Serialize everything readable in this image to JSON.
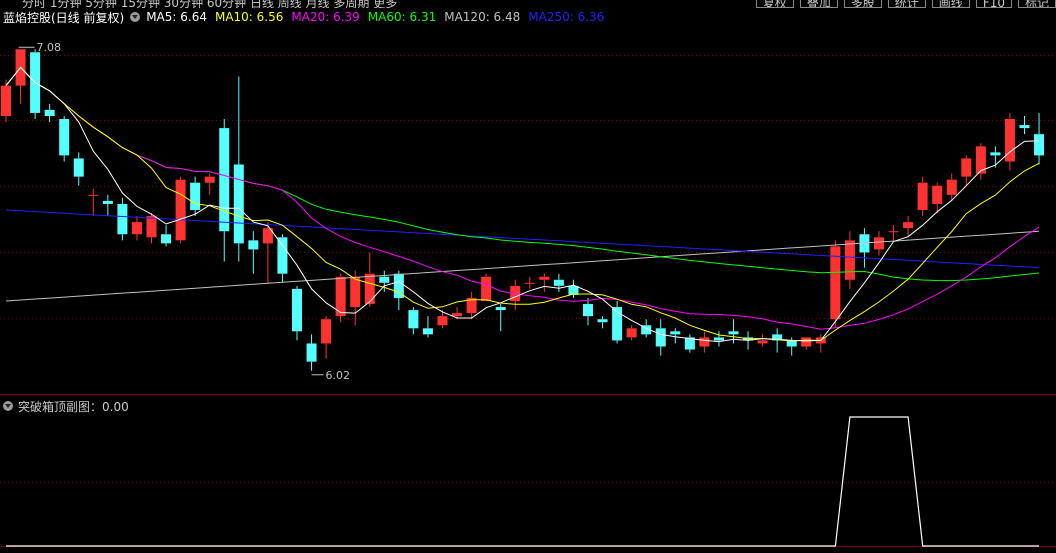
{
  "toolbar": {
    "periods_text": "分时 1分钟 5分钟 15分钟 30分钟 60分钟 日线 周线 月线 多周期 更多",
    "buttons": [
      "复权",
      "叠加",
      "多股",
      "统计",
      "画线",
      "F10",
      "标记"
    ]
  },
  "main_legend": {
    "title": "蓝焰控股(日线 前复权)",
    "ma": [
      {
        "label": "MA5: 6.64",
        "color": "#ffffff"
      },
      {
        "label": "MA10: 6.56",
        "color": "#ffff00"
      },
      {
        "label": "MA20: 6.39",
        "color": "#ff00ff"
      },
      {
        "label": "MA60: 6.31",
        "color": "#00ff00"
      },
      {
        "label": "MA120: 6.48",
        "color": "#c0c0c0"
      },
      {
        "label": "MA250: 6.36",
        "color": "#2020ff"
      }
    ]
  },
  "sub_legend": {
    "title": "突破箱顶副图：0.00"
  },
  "colors": {
    "up": "#ff3232",
    "down": "#54ffff",
    "grid": "#800000",
    "ma5": "#ffffff",
    "ma10": "#ffff00",
    "ma20": "#ff00ff",
    "ma60": "#00ff00",
    "ma120": "#c0c0c0",
    "ma250": "#2020ff",
    "indicator": "#ffffff"
  },
  "chart_data": [
    {
      "type": "candlestick",
      "ylim": [
        5.95,
        7.15
      ],
      "annotations": {
        "high": "7.08",
        "low": "6.02",
        "high_value": 7.08,
        "low_value": 6.02,
        "high_index": 1,
        "low_index": 21
      },
      "candles": [
        [
          6.86,
          6.96,
          6.98,
          6.84
        ],
        [
          6.96,
          7.08,
          7.08,
          6.9
        ],
        [
          7.07,
          6.87,
          7.08,
          6.85
        ],
        [
          6.88,
          6.86,
          6.9,
          6.84
        ],
        [
          6.85,
          6.73,
          6.86,
          6.71
        ],
        [
          6.72,
          6.66,
          6.74,
          6.63
        ],
        [
          6.6,
          6.6,
          6.62,
          6.53
        ],
        [
          6.58,
          6.57,
          6.6,
          6.53
        ],
        [
          6.57,
          6.47,
          6.59,
          6.45
        ],
        [
          6.47,
          6.51,
          6.53,
          6.45
        ],
        [
          6.46,
          6.53,
          6.54,
          6.44
        ],
        [
          6.47,
          6.44,
          6.5,
          6.43
        ],
        [
          6.45,
          6.65,
          6.66,
          6.44
        ],
        [
          6.64,
          6.55,
          6.66,
          6.53
        ],
        [
          6.64,
          6.66,
          6.67,
          6.6
        ],
        [
          6.82,
          6.48,
          6.85,
          6.38
        ],
        [
          6.7,
          6.44,
          6.99,
          6.38
        ],
        [
          6.45,
          6.42,
          6.48,
          6.34
        ],
        [
          6.44,
          6.49,
          6.51,
          6.31
        ],
        [
          6.46,
          6.34,
          6.47,
          6.31
        ],
        [
          6.29,
          6.15,
          6.3,
          6.12
        ],
        [
          6.11,
          6.05,
          6.14,
          6.02
        ],
        [
          6.11,
          6.19,
          6.2,
          6.06
        ],
        [
          6.2,
          6.33,
          6.34,
          6.18
        ],
        [
          6.23,
          6.33,
          6.35,
          6.17
        ],
        [
          6.24,
          6.34,
          6.41,
          6.23
        ],
        [
          6.33,
          6.31,
          6.35,
          6.28
        ],
        [
          6.34,
          6.26,
          6.35,
          6.22
        ],
        [
          6.22,
          6.16,
          6.23,
          6.14
        ],
        [
          6.16,
          6.14,
          6.2,
          6.13
        ],
        [
          6.17,
          6.2,
          6.22,
          6.16
        ],
        [
          6.2,
          6.21,
          6.23,
          6.19
        ],
        [
          6.21,
          6.26,
          6.28,
          6.19
        ],
        [
          6.25,
          6.33,
          6.34,
          6.25
        ],
        [
          6.23,
          6.22,
          6.24,
          6.15
        ],
        [
          6.25,
          6.3,
          6.32,
          6.22
        ],
        [
          6.31,
          6.31,
          6.33,
          6.29
        ],
        [
          6.32,
          6.33,
          6.34,
          6.28
        ],
        [
          6.32,
          6.3,
          6.34,
          6.28
        ],
        [
          6.3,
          6.27,
          6.32,
          6.26
        ],
        [
          6.24,
          6.2,
          6.26,
          6.17
        ],
        [
          6.19,
          6.18,
          6.2,
          6.16
        ],
        [
          6.23,
          6.12,
          6.25,
          6.11
        ],
        [
          6.13,
          6.16,
          6.17,
          6.12
        ],
        [
          6.17,
          6.14,
          6.19,
          6.13
        ],
        [
          6.16,
          6.1,
          6.19,
          6.07
        ],
        [
          6.15,
          6.14,
          6.16,
          6.11
        ],
        [
          6.13,
          6.09,
          6.14,
          6.08
        ],
        [
          6.1,
          6.13,
          6.15,
          6.08
        ],
        [
          6.13,
          6.12,
          6.15,
          6.1
        ],
        [
          6.15,
          6.14,
          6.19,
          6.11
        ],
        [
          6.13,
          6.12,
          6.15,
          6.09
        ],
        [
          6.11,
          6.12,
          6.14,
          6.1
        ],
        [
          6.14,
          6.12,
          6.16,
          6.08
        ],
        [
          6.12,
          6.1,
          6.13,
          6.07
        ],
        [
          6.1,
          6.13,
          6.13,
          6.09
        ],
        [
          6.11,
          6.13,
          6.14,
          6.08
        ],
        [
          6.19,
          6.43,
          6.45,
          6.16
        ],
        [
          6.32,
          6.45,
          6.48,
          6.29
        ],
        [
          6.47,
          6.41,
          6.49,
          6.36
        ],
        [
          6.42,
          6.46,
          6.48,
          6.4
        ],
        [
          6.48,
          6.48,
          6.5,
          6.45
        ],
        [
          6.49,
          6.51,
          6.53,
          6.46
        ],
        [
          6.55,
          6.64,
          6.66,
          6.53
        ],
        [
          6.57,
          6.63,
          6.64,
          6.54
        ],
        [
          6.6,
          6.65,
          6.67,
          6.58
        ],
        [
          6.66,
          6.72,
          6.73,
          6.63
        ],
        [
          6.67,
          6.76,
          6.77,
          6.65
        ],
        [
          6.74,
          6.73,
          6.76,
          6.69
        ],
        [
          6.71,
          6.85,
          6.87,
          6.68
        ],
        [
          6.83,
          6.82,
          6.86,
          6.8
        ],
        [
          6.8,
          6.73,
          6.87,
          6.7
        ]
      ]
    },
    {
      "type": "line",
      "name": "突破箱顶副图",
      "ylim": [
        0,
        1
      ],
      "values": [
        0,
        0,
        0,
        0,
        0,
        0,
        0,
        0,
        0,
        0,
        0,
        0,
        0,
        0,
        0,
        0,
        0,
        0,
        0,
        0,
        0,
        0,
        0,
        0,
        0,
        0,
        0,
        0,
        0,
        0,
        0,
        0,
        0,
        0,
        0,
        0,
        0,
        0,
        0,
        0,
        0,
        0,
        0,
        0,
        0,
        0,
        0,
        0,
        0,
        0,
        0,
        0,
        0,
        0,
        0,
        0,
        0,
        0,
        1,
        1,
        1,
        1,
        1,
        0,
        0,
        0,
        0,
        0,
        0,
        0,
        0,
        0
      ]
    }
  ]
}
